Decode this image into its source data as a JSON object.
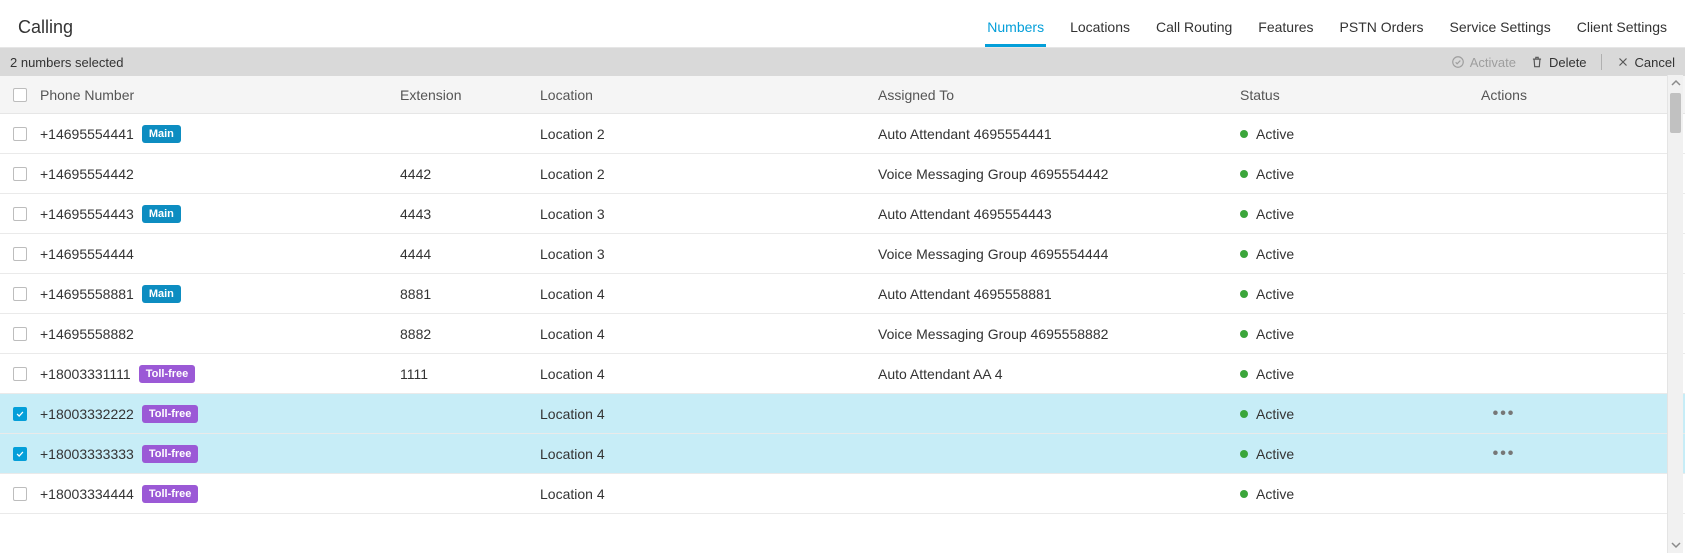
{
  "header": {
    "title": "Calling",
    "tabs": [
      {
        "label": "Numbers",
        "active": true
      },
      {
        "label": "Locations",
        "active": false
      },
      {
        "label": "Call Routing",
        "active": false
      },
      {
        "label": "Features",
        "active": false
      },
      {
        "label": "PSTN Orders",
        "active": false
      },
      {
        "label": "Service Settings",
        "active": false
      },
      {
        "label": "Client Settings",
        "active": false
      }
    ]
  },
  "selection_bar": {
    "summary": "2 numbers selected",
    "activate_label": "Activate",
    "delete_label": "Delete",
    "cancel_label": "Cancel"
  },
  "columns": {
    "phone": "Phone Number",
    "extension": "Extension",
    "location": "Location",
    "assigned": "Assigned To",
    "status": "Status",
    "actions": "Actions"
  },
  "badges": {
    "main": "Main",
    "toll_free": "Toll-free"
  },
  "status_labels": {
    "active": "Active"
  },
  "rows": [
    {
      "phone": "+14695554441",
      "badge": "main",
      "extension": "",
      "location": "Location 2",
      "assigned": "Auto Attendant 4695554441",
      "status": "active",
      "selected": false,
      "show_actions": false
    },
    {
      "phone": "+14695554442",
      "badge": "",
      "extension": "4442",
      "location": "Location 2",
      "assigned": "Voice Messaging Group 4695554442",
      "status": "active",
      "selected": false,
      "show_actions": false
    },
    {
      "phone": "+14695554443",
      "badge": "main",
      "extension": "4443",
      "location": "Location 3",
      "assigned": "Auto Attendant 4695554443",
      "status": "active",
      "selected": false,
      "show_actions": false
    },
    {
      "phone": "+14695554444",
      "badge": "",
      "extension": "4444",
      "location": "Location 3",
      "assigned": "Voice Messaging Group 4695554444",
      "status": "active",
      "selected": false,
      "show_actions": false
    },
    {
      "phone": "+14695558881",
      "badge": "main",
      "extension": "8881",
      "location": "Location 4",
      "assigned": "Auto Attendant 4695558881",
      "status": "active",
      "selected": false,
      "show_actions": false
    },
    {
      "phone": "+14695558882",
      "badge": "",
      "extension": "8882",
      "location": "Location 4",
      "assigned": "Voice Messaging Group 4695558882",
      "status": "active",
      "selected": false,
      "show_actions": false
    },
    {
      "phone": "+18003331111",
      "badge": "toll_free",
      "extension": "1111",
      "location": "Location 4",
      "assigned": "Auto Attendant AA 4",
      "status": "active",
      "selected": false,
      "show_actions": false
    },
    {
      "phone": "+18003332222",
      "badge": "toll_free",
      "extension": "",
      "location": "Location 4",
      "assigned": "",
      "status": "active",
      "selected": true,
      "show_actions": true
    },
    {
      "phone": "+18003333333",
      "badge": "toll_free",
      "extension": "",
      "location": "Location 4",
      "assigned": "",
      "status": "active",
      "selected": true,
      "show_actions": true
    },
    {
      "phone": "+18003334444",
      "badge": "toll_free",
      "extension": "",
      "location": "Location 4",
      "assigned": "",
      "status": "active",
      "selected": false,
      "show_actions": false
    }
  ]
}
